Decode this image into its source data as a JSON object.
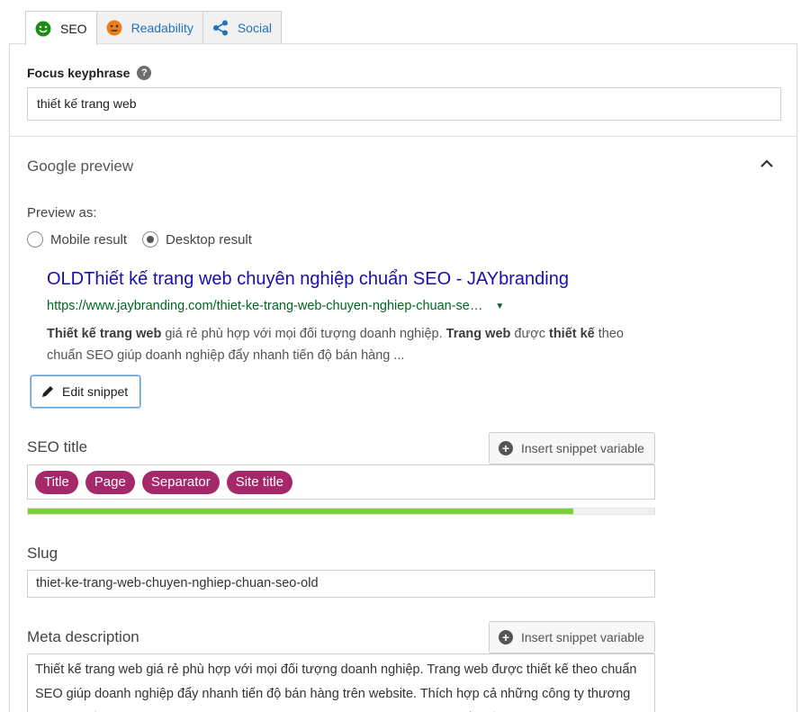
{
  "tabs": [
    {
      "label": "SEO",
      "icon": "smiley-green-icon",
      "color": "#1e8c17",
      "active": true
    },
    {
      "label": "Readability",
      "icon": "smiley-orange-icon",
      "color": "#ee7c1b",
      "active": false
    },
    {
      "label": "Social",
      "icon": "share-icon",
      "color": "#1e73be",
      "active": false
    }
  ],
  "focus_keyphrase": {
    "label": "Focus keyphrase",
    "help": "?",
    "value": "thiết kế trang web"
  },
  "google_preview": {
    "title": "Google preview",
    "preview_as_label": "Preview as:",
    "options": {
      "mobile": "Mobile result",
      "desktop": "Desktop result"
    },
    "selected": "desktop",
    "result": {
      "title": "OLDThiết kế trang web chuyên nghiệp chuẩn SEO - JAYbranding",
      "url": "https://www.jaybranding.com/thiet-ke-trang-web-chuyen-nghiep-chuan-se…",
      "desc_b1": "Thiết kế trang web",
      "desc_t1": " giá rẻ phù hợp với mọi đối tượng doanh nghiệp. ",
      "desc_b2": "Trang web",
      "desc_t2": " được ",
      "desc_b3": "thiết kế",
      "desc_t3": " theo chuẩn SEO giúp doanh nghiệp đẩy nhanh tiến độ bán hàng ..."
    },
    "edit_button": "Edit snippet"
  },
  "seo_title": {
    "label": "SEO title",
    "insert_button": "Insert snippet variable",
    "pills": [
      "Title",
      "Page",
      "Separator",
      "Site title"
    ],
    "progress_fraction": 0.87,
    "progress_color": "#7ad03a"
  },
  "slug": {
    "label": "Slug",
    "value": "thiet-ke-trang-web-chuyen-nghiep-chuan-seo-old"
  },
  "meta_description": {
    "label": "Meta description",
    "insert_button": "Insert snippet variable",
    "value": "Thiết kế trang web giá rẻ phù hợp với mọi đối tượng doanh nghiệp. Trang web được thiết kế theo chuẩn SEO giúp doanh nghiệp đẩy nhanh tiến độ bán hàng trên website. Thích hợp cả những công ty thương mại điện tử hoặc doanh nghiệp tự giới thiệu. Tương thích responsive mọi nền tảng. Gọi"
  },
  "colors": {
    "pill": "#a4286a",
    "link": "#1a0dab",
    "url": "#006621"
  }
}
